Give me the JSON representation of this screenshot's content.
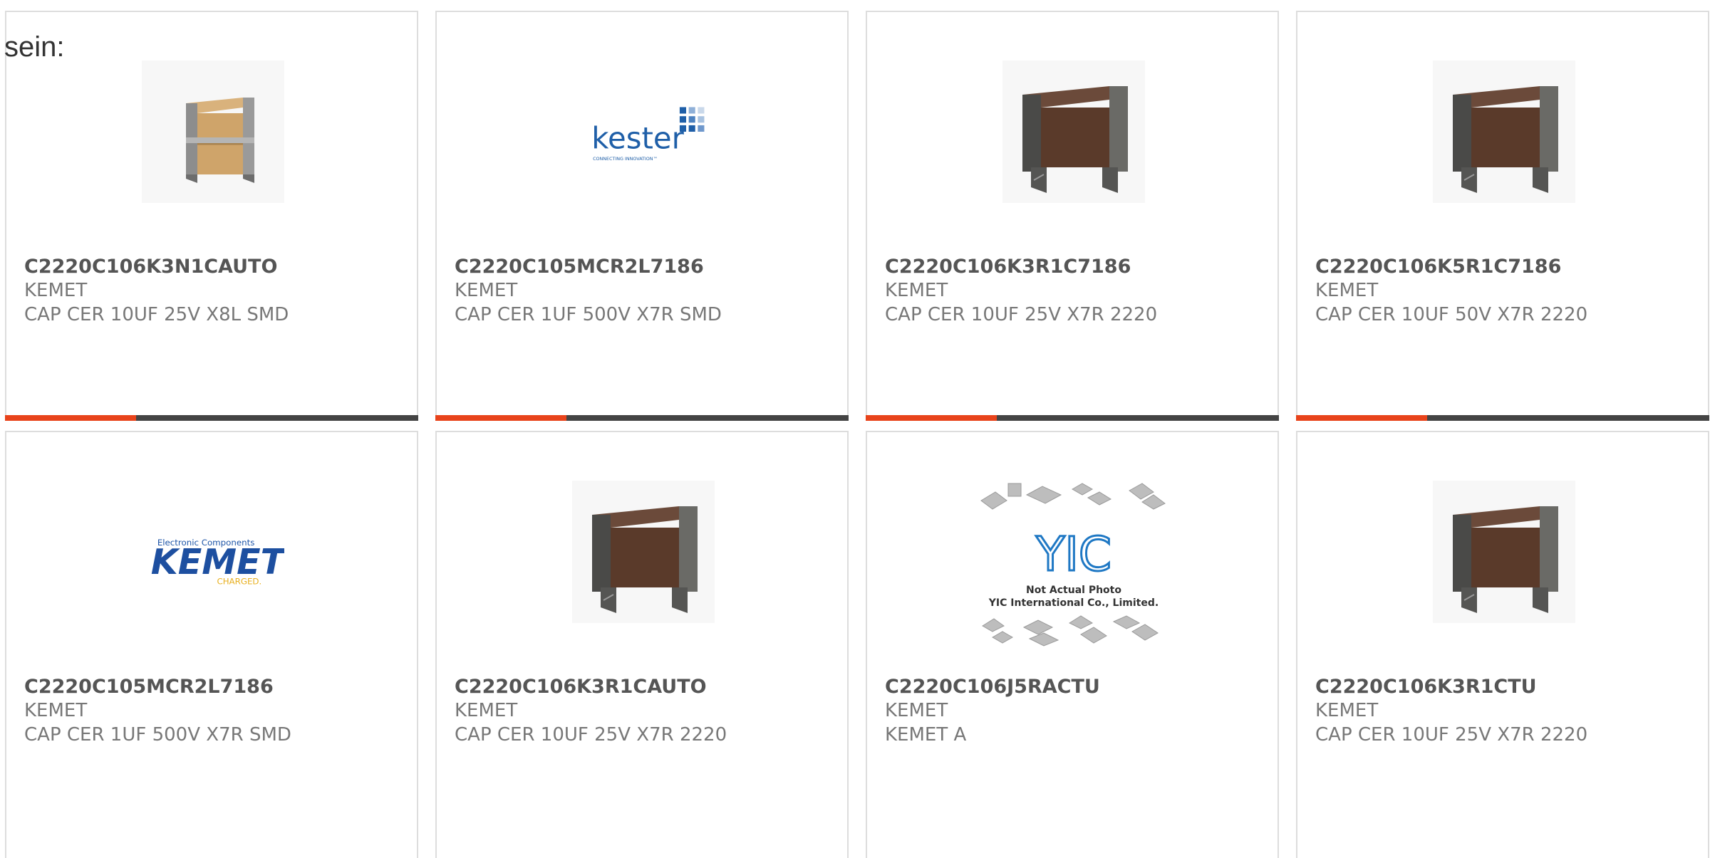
{
  "intro_text": "sein:",
  "accent_color": "#e8431b",
  "bar_color": "#444444",
  "products": [
    {
      "part": "C2220C106K3N1CAUTO",
      "manufacturer": "KEMET",
      "description": "CAP CER 10UF 25V X8L SMD",
      "image": "capacitor-tan-icon"
    },
    {
      "part": "C2220C105MCR2L7186",
      "manufacturer": "KEMET",
      "description": "CAP CER 1UF 500V X7R SMD",
      "image": "kester-logo",
      "logo": {
        "word": "kester",
        "tagline": "CONNECTING INNOVATION™"
      }
    },
    {
      "part": "C2220C106K3R1C7186",
      "manufacturer": "KEMET",
      "description": "CAP CER 10UF 25V X7R 2220",
      "image": "capacitor-brown-icon"
    },
    {
      "part": "C2220C106K5R1C7186",
      "manufacturer": "KEMET",
      "description": "CAP CER 10UF 50V X7R 2220",
      "image": "capacitor-brown-icon"
    },
    {
      "part": "C2220C105MCR2L7186",
      "manufacturer": "KEMET",
      "description": "CAP CER 1UF 500V X7R SMD",
      "image": "kemet-logo",
      "logo": {
        "top": "Electronic Components",
        "word": "KEMET",
        "tagline": "CHARGED."
      }
    },
    {
      "part": "C2220C106K3R1CAUTO",
      "manufacturer": "KEMET",
      "description": "CAP CER 10UF 25V X7R 2220",
      "image": "capacitor-brown-icon"
    },
    {
      "part": "C2220C106J5RACTU",
      "manufacturer": "KEMET",
      "description": "KEMET A",
      "image": "yic-placeholder",
      "logo": {
        "word": "YIC",
        "line1": "Not Actual Photo",
        "line2": "YIC International Co., Limited."
      }
    },
    {
      "part": "C2220C106K3R1CTU",
      "manufacturer": "KEMET",
      "description": "CAP CER 10UF 25V X7R 2220",
      "image": "capacitor-brown-icon"
    }
  ]
}
